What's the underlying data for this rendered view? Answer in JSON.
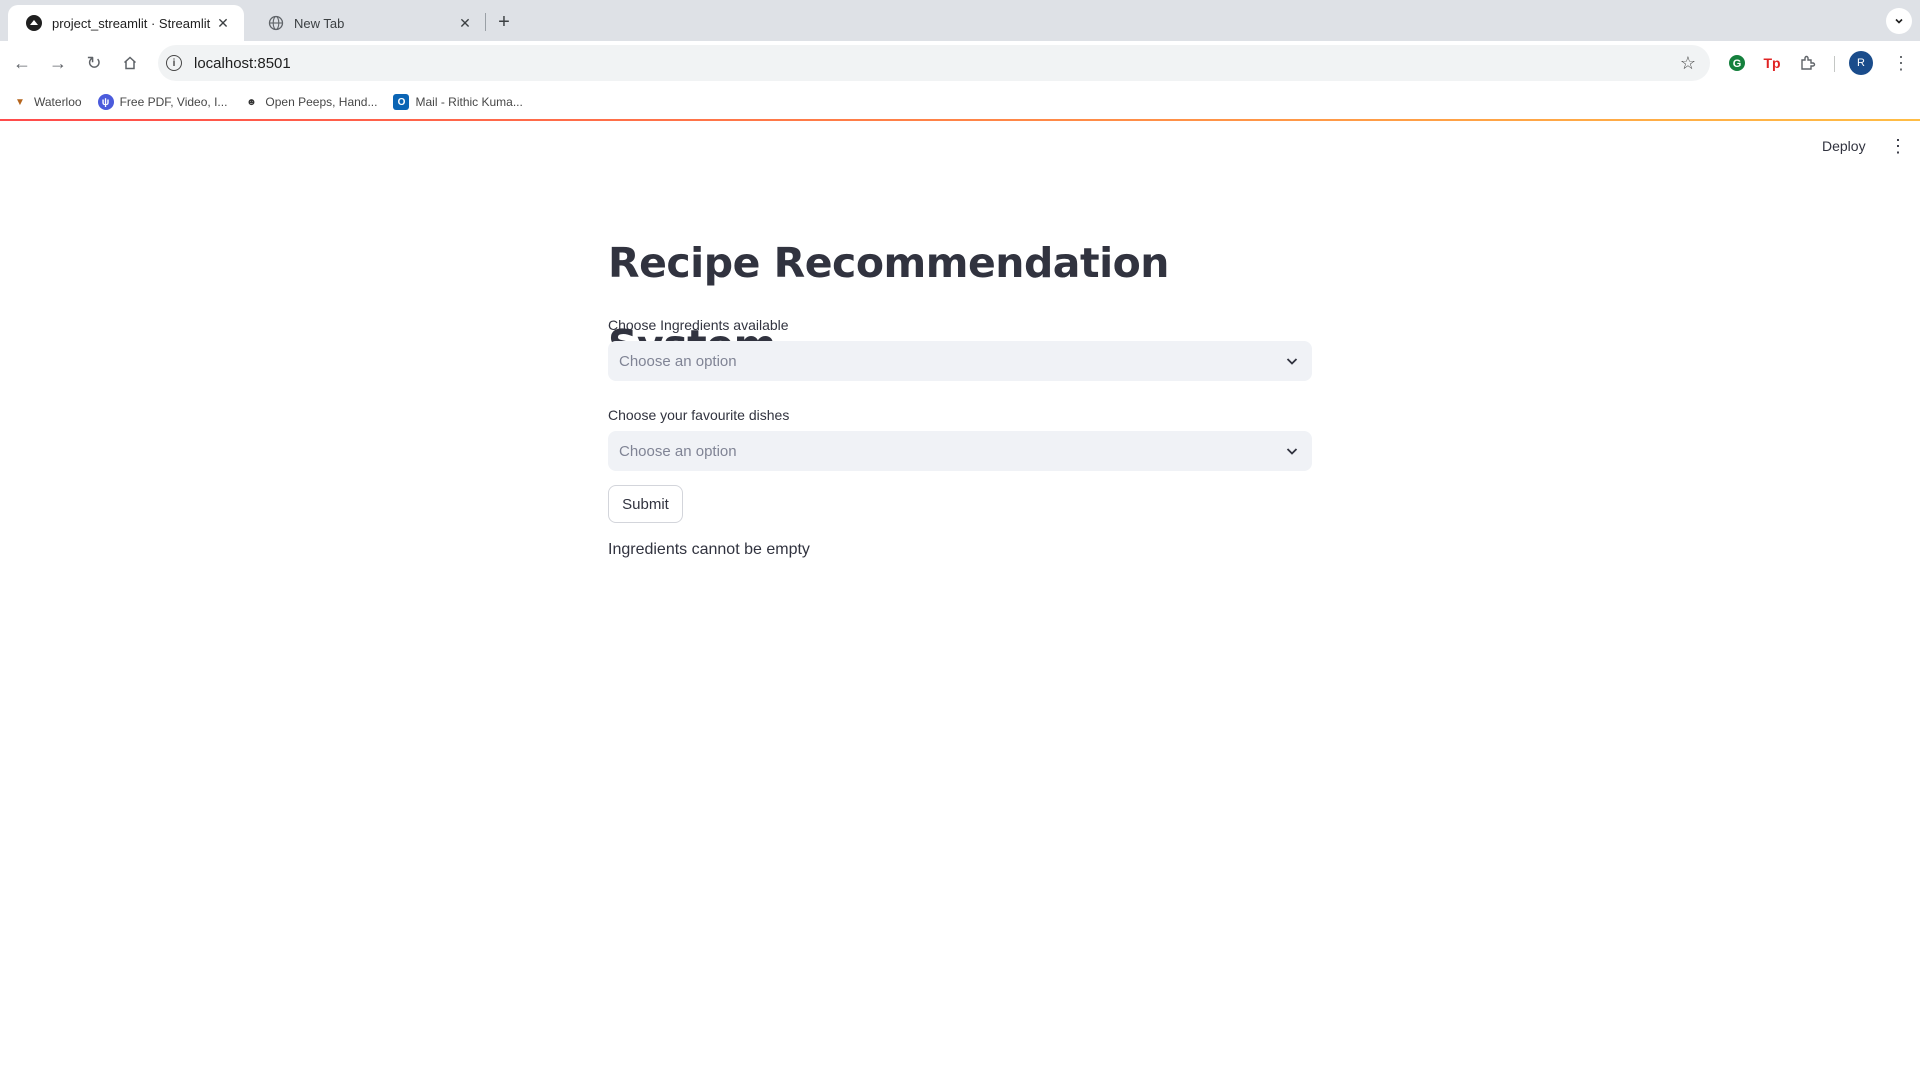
{
  "browser": {
    "tabs": [
      {
        "title": "project_streamlit · Streamlit",
        "icon": "streamlit-icon",
        "active": true
      },
      {
        "title": "New Tab",
        "icon": "globe-icon",
        "active": false
      }
    ],
    "address": "localhost:8501",
    "bookmarks": [
      {
        "label": "Waterloo",
        "icon": "waterloo-icon",
        "color": "#b5651d"
      },
      {
        "label": "Free PDF, Video, I...",
        "icon": "pdf-tool-icon",
        "color": "#4b5bdc"
      },
      {
        "label": "Open Peeps, Hand...",
        "icon": "peeps-icon",
        "color": "#333333"
      },
      {
        "label": "Mail - Rithic Kuma...",
        "icon": "outlook-icon",
        "color": "#0a64b4"
      }
    ],
    "avatar_initial": "R"
  },
  "app": {
    "deploy_label": "Deploy",
    "title": "Recipe Recommendation System",
    "ingredients": {
      "label": "Choose Ingredients available",
      "placeholder": "Choose an option"
    },
    "dishes": {
      "label": "Choose your favourite dishes",
      "placeholder": "Choose an option"
    },
    "submit_label": "Submit",
    "message": "Ingredients cannot be empty"
  },
  "colors": {
    "accent_start": "#ff4b4b",
    "accent_end": "#ffbd45",
    "text": "#31333f",
    "select_bg": "#f0f2f6"
  }
}
